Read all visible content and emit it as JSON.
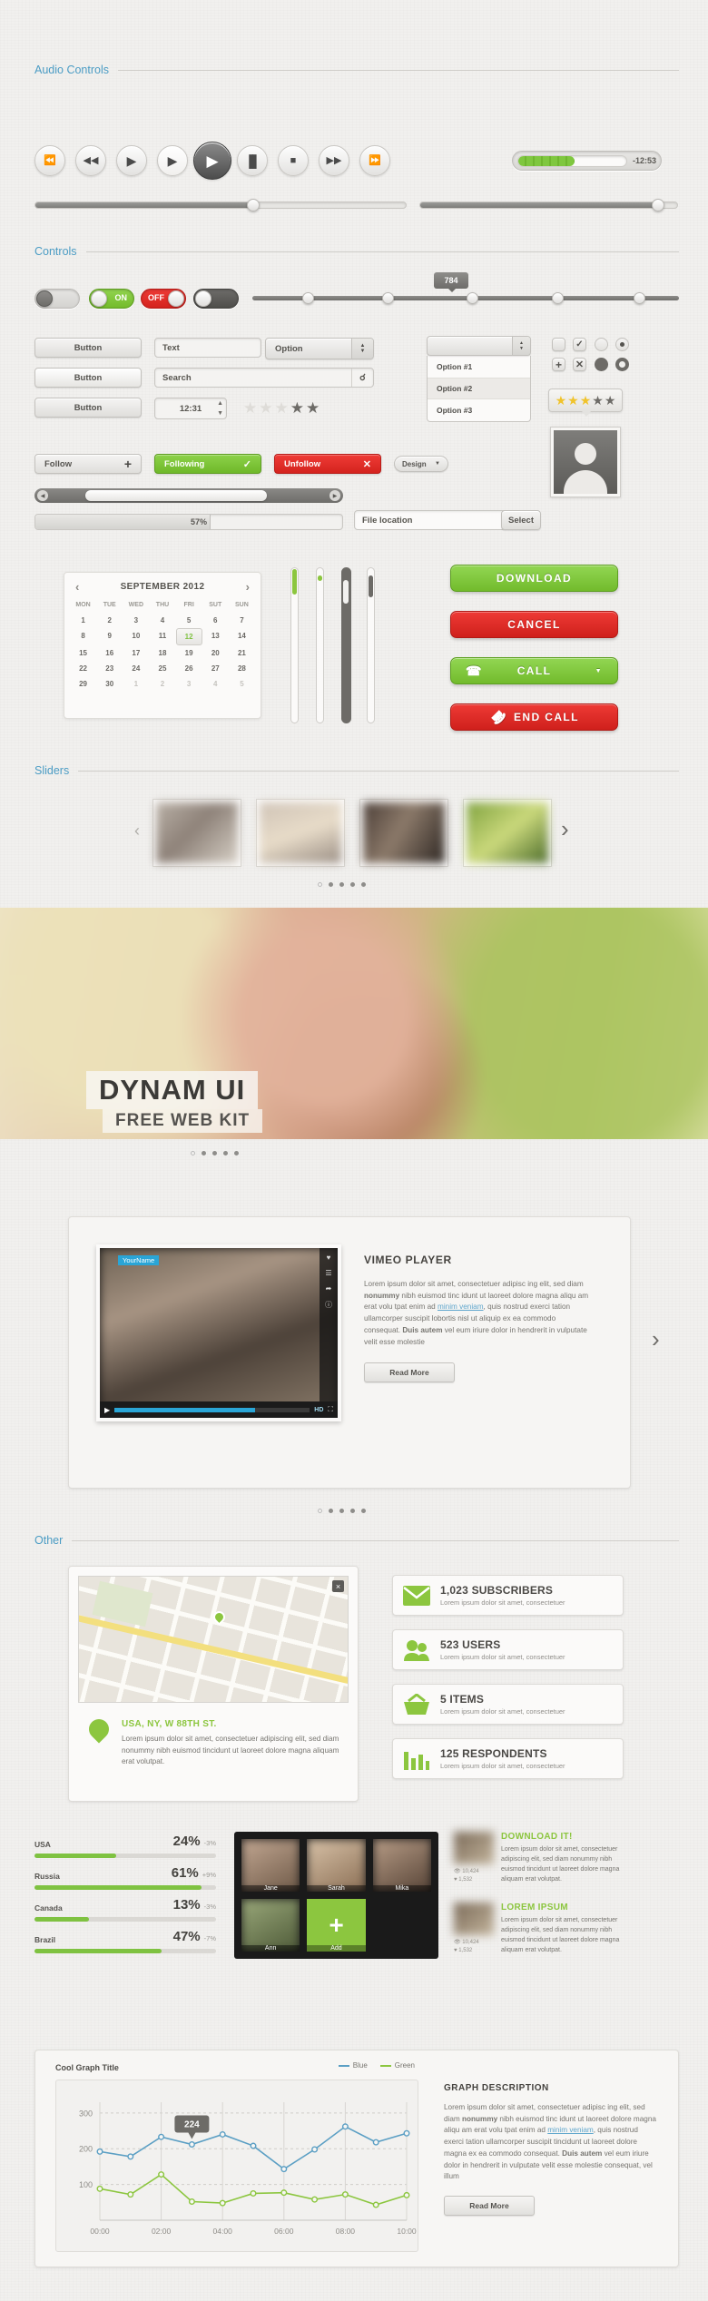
{
  "sections": {
    "audio": "Audio Controls",
    "controls": "Controls",
    "sliders": "Sliders",
    "other": "Other"
  },
  "audio_controls": {
    "buttons": [
      {
        "name": "prev-track",
        "glyph": "⏮"
      },
      {
        "name": "rewind",
        "glyph": "◀◀"
      },
      {
        "name": "play",
        "glyph": "▶"
      },
      {
        "name": "play-alt",
        "glyph": "▶"
      },
      {
        "name": "play-active",
        "glyph": "▶"
      },
      {
        "name": "pause",
        "glyph": "▐▌"
      },
      {
        "name": "stop",
        "glyph": "■"
      },
      {
        "name": "forward",
        "glyph": "▶▶"
      },
      {
        "name": "next-track",
        "glyph": "⏭"
      }
    ],
    "time_remaining": "-12:53",
    "volume_percent": 52,
    "progress_percent": 60,
    "progress2_percent": 93
  },
  "controls": {
    "toggle_plain": "",
    "toggle_on": "ON",
    "toggle_off": "OFF",
    "slider_tooltip": "784",
    "buttons": [
      "Button",
      "Button",
      "Button"
    ],
    "text_input": "Text",
    "search_input": "Search",
    "time_input": "12:31",
    "select_label": "Option",
    "dropdown_options": [
      "Option #1",
      "Option #2",
      "Option #3"
    ],
    "rating_stars_filled": 2,
    "rating_stars_total": 5,
    "rating_gold_filled": 3,
    "rating_gold_total": 5,
    "icon_buttons": [
      "plus-icon",
      "close-icon"
    ],
    "follow": "Follow",
    "following": "Following",
    "unfollow": "Unfollow",
    "design": "Design",
    "progress_label": "57%",
    "progress_value": 57,
    "file_location_label": "File location",
    "file_select_label": "Select"
  },
  "calendar": {
    "title": "SEPTEMBER 2012",
    "prev": "‹",
    "next": "›",
    "weekdays": [
      "MON",
      "TUE",
      "WED",
      "THU",
      "FRI",
      "SUT",
      "SUN"
    ],
    "weeks": [
      [
        "1",
        "2",
        "3",
        "4",
        "5",
        "6",
        "7"
      ],
      [
        "8",
        "9",
        "10",
        "11",
        "12",
        "13",
        "14"
      ],
      [
        "15",
        "16",
        "17",
        "18",
        "19",
        "20",
        "21"
      ],
      [
        "22",
        "23",
        "24",
        "25",
        "26",
        "27",
        "28"
      ],
      [
        "29",
        "30",
        "1",
        "2",
        "3",
        "4",
        "5"
      ]
    ],
    "selected": "12",
    "muted_last_row_from": 2
  },
  "action_buttons": {
    "download": "DOWNLOAD",
    "cancel": "CANCEL",
    "call": "CALL",
    "end_call": "END CALL"
  },
  "hero": {
    "title": "DYNAM UI",
    "subtitle": "FREE WEB KIT",
    "dots": 5,
    "active_dot": 0
  },
  "vimeo": {
    "heading": "VIMEO PLAYER",
    "body_1": "Lorem ipsum dolor sit amet, consectetuer adipisc ing elit, sed diam ",
    "body_bold_1": "nonummy",
    "body_2": " nibh euismod tinc idunt ut laoreet dolore magna aliqu am erat volu tpat enim ad ",
    "body_link": "minim veniam",
    "body_3": ", quis nostrud exerci tation ullamcorper suscipit lobortis nisl ut aliquip ex ea commodo consequat. ",
    "body_bold_2": "Duis autem",
    "body_4": " vel eum iriure dolor in hendrerit in vulputate velit esse molestie",
    "read_more": "Read More",
    "badge_name": "YourName",
    "hd": "HD",
    "dots": 5,
    "active_dot": 0
  },
  "map": {
    "address_title": "USA, NY, W 88TH ST.",
    "address_body": "Lorem ipsum dolor sit amet, consectetuer adipiscing elit, sed diam nonummy nibh euismod tincidunt ut laoreet dolore magna aliquam erat volutpat.",
    "close": "×"
  },
  "stat_cards": [
    {
      "icon": "envelope-icon",
      "title": "1,023 SUBSCRIBERS",
      "sub": "Lorem ipsum dolor sit amet, consectetuer"
    },
    {
      "icon": "users-icon",
      "title": "523 USERS",
      "sub": "Lorem ipsum dolor sit amet, consectetuer"
    },
    {
      "icon": "basket-icon",
      "title": "5 ITEMS",
      "sub": "Lorem ipsum dolor sit amet, consectetuer"
    },
    {
      "icon": "barchart-icon",
      "title": "125 RESPONDENTS",
      "sub": "Lorem ipsum dolor sit amet, consectetuer"
    }
  ],
  "country_stats": [
    {
      "label": "USA",
      "value": "24%",
      "delta": "-3%",
      "percent": 45
    },
    {
      "label": "Russia",
      "value": "61%",
      "delta": "+9%",
      "percent": 92
    },
    {
      "label": "Canada",
      "value": "13%",
      "delta": "-3%",
      "percent": 30
    },
    {
      "label": "Brazil",
      "value": "47%",
      "delta": "-7%",
      "percent": 70
    }
  ],
  "photo_grid": {
    "labels": [
      "Jane",
      "Sarah",
      "Mika",
      "Ann",
      "Add"
    ],
    "add_glyph": "+"
  },
  "promos": [
    {
      "heading": "DOWNLOAD IT!",
      "body": "Lorem ipsum dolor sit amet, consectetuer adipiscing elit, sed diam nonummy nibh euismod tincidunt ut laoreet dolore magna aliquam erat volutpat.",
      "views": "10,424",
      "likes": "1,532"
    },
    {
      "heading": "LOREM IPSUM",
      "body": "Lorem ipsum dolor sit amet, consectetuer adipiscing elit, sed diam nonummy nibh euismod tincidunt ut laoreet dolore magna aliquam erat volutpat.",
      "views": "10,424",
      "likes": "1,532"
    }
  ],
  "graph_panel": {
    "description_heading": "GRAPH DESCRIPTION",
    "body_1": "Lorem ipsum dolor sit amet, consectetuer adipisc ing elit, sed diam ",
    "body_bold_1": "nonummy",
    "body_2": " nibh euismod tinc idunt ut laoreet dolore magna aliqu am erat volu tpat enim ad ",
    "body_link": "minim veniam",
    "body_3": ", quis nostrud exerci tation ullamcorper suscipit tincidunt ut laoreet dolore magna ex ea commodo consequat. ",
    "body_bold_2": "Duis autem",
    "body_4": " vel eum iriure dolor in hendrerit in vulputate velit esse molestie consequat, vel illum",
    "read_more": "Read More"
  },
  "chart_data": {
    "type": "line",
    "title": "Cool Graph Title",
    "xlabel": "",
    "ylabel": "",
    "x": [
      "00:00",
      "01:00",
      "02:00",
      "03:00",
      "04:00",
      "05:00",
      "06:00",
      "07:00",
      "08:00",
      "09:00",
      "10:00"
    ],
    "tick_labels": [
      "00:00",
      "02:00",
      "04:00",
      "06:00",
      "08:00",
      "10:00"
    ],
    "yticks": [
      100,
      200,
      300
    ],
    "ylim": [
      0,
      330
    ],
    "grid": true,
    "legend_position": "top-right",
    "annotation": {
      "label": "224",
      "x": "03:00",
      "y": 212
    },
    "series": [
      {
        "name": "Blue",
        "color": "#5b9fc4",
        "values": [
          192,
          178,
          233,
          212,
          240,
          208,
          143,
          198,
          262,
          218,
          243
        ]
      },
      {
        "name": "Green",
        "color": "#8cc63f",
        "values": [
          88,
          72,
          128,
          52,
          48,
          75,
          77,
          58,
          72,
          43,
          70
        ]
      }
    ]
  }
}
